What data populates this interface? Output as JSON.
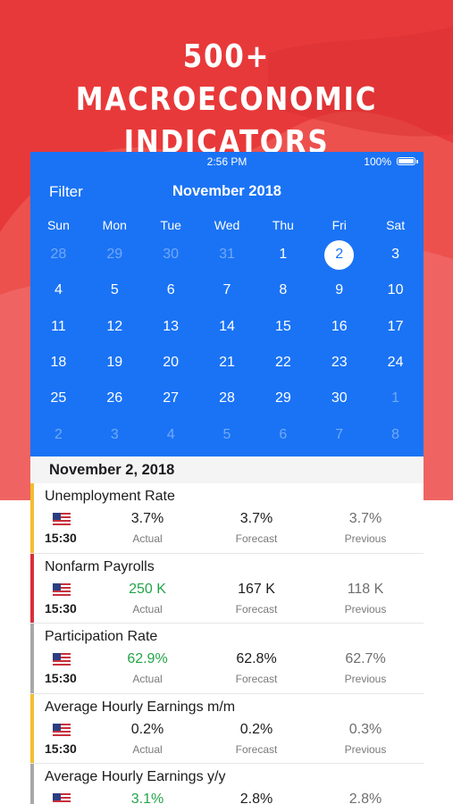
{
  "headline": {
    "line1": "500+ MACROECONOMIC",
    "line2": "INDICATORS"
  },
  "colors": {
    "background_red": "#e8393a",
    "calendar_blue": "#1a73f5",
    "actual_green": "#22a548",
    "importance_high": "#d8303a",
    "importance_medium": "#f2be2f",
    "importance_low": "#a8a8a8"
  },
  "status_bar": {
    "time": "2:56 PM",
    "battery": "100%"
  },
  "calendar": {
    "filter_label": "Filter",
    "month_title": "November 2018",
    "weekdays": [
      "Sun",
      "Mon",
      "Tue",
      "Wed",
      "Thu",
      "Fri",
      "Sat"
    ],
    "weeks": [
      [
        {
          "d": "28",
          "dim": true
        },
        {
          "d": "29",
          "dim": true
        },
        {
          "d": "30",
          "dim": true
        },
        {
          "d": "31",
          "dim": true
        },
        {
          "d": "1"
        },
        {
          "d": "2",
          "selected": true
        },
        {
          "d": "3"
        }
      ],
      [
        {
          "d": "4"
        },
        {
          "d": "5"
        },
        {
          "d": "6"
        },
        {
          "d": "7"
        },
        {
          "d": "8"
        },
        {
          "d": "9"
        },
        {
          "d": "10"
        }
      ],
      [
        {
          "d": "11"
        },
        {
          "d": "12"
        },
        {
          "d": "13"
        },
        {
          "d": "14"
        },
        {
          "d": "15"
        },
        {
          "d": "16"
        },
        {
          "d": "17"
        }
      ],
      [
        {
          "d": "18"
        },
        {
          "d": "19"
        },
        {
          "d": "20"
        },
        {
          "d": "21"
        },
        {
          "d": "22"
        },
        {
          "d": "23"
        },
        {
          "d": "24"
        }
      ],
      [
        {
          "d": "25"
        },
        {
          "d": "26"
        },
        {
          "d": "27"
        },
        {
          "d": "28"
        },
        {
          "d": "29"
        },
        {
          "d": "30"
        },
        {
          "d": "1",
          "dim": true
        }
      ],
      [
        {
          "d": "2",
          "dim": true
        },
        {
          "d": "3",
          "dim": true
        },
        {
          "d": "4",
          "dim": true
        },
        {
          "d": "5",
          "dim": true
        },
        {
          "d": "6",
          "dim": true
        },
        {
          "d": "7",
          "dim": true
        },
        {
          "d": "8",
          "dim": true
        }
      ]
    ]
  },
  "selected_date_label": "November 2, 2018",
  "column_labels": {
    "actual": "Actual",
    "forecast": "Forecast",
    "previous": "Previous"
  },
  "events": [
    {
      "name": "Unemployment Rate",
      "time": "15:30",
      "flag": "us-flag-icon",
      "importance": "medium",
      "actual": "3.7%",
      "actual_better": false,
      "forecast": "3.7%",
      "previous": "3.7%"
    },
    {
      "name": "Nonfarm Payrolls",
      "time": "15:30",
      "flag": "us-flag-icon",
      "importance": "high",
      "actual": "250 K",
      "actual_better": true,
      "forecast": "167 K",
      "previous": "118 K"
    },
    {
      "name": "Participation Rate",
      "time": "15:30",
      "flag": "us-flag-icon",
      "importance": "low",
      "actual": "62.9%",
      "actual_better": true,
      "forecast": "62.8%",
      "previous": "62.7%"
    },
    {
      "name": "Average Hourly Earnings m/m",
      "time": "15:30",
      "flag": "us-flag-icon",
      "importance": "medium",
      "actual": "0.2%",
      "actual_better": false,
      "forecast": "0.2%",
      "previous": "0.3%"
    },
    {
      "name": "Average Hourly Earnings y/y",
      "time": "",
      "flag": "us-flag-icon",
      "importance": "low",
      "actual": "3.1%",
      "actual_better": true,
      "forecast": "2.8%",
      "previous": "2.8%"
    }
  ]
}
